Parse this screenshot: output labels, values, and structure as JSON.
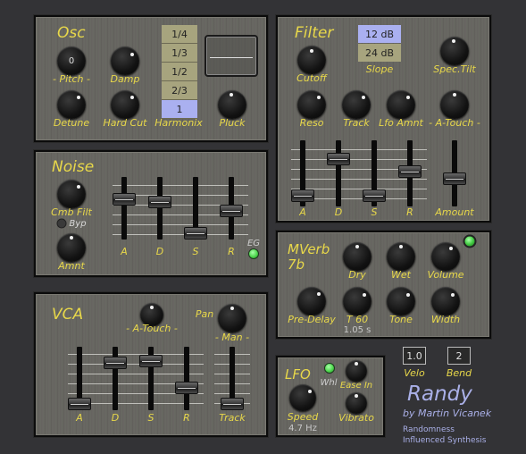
{
  "osc": {
    "title": "Osc",
    "pitch_value": "0",
    "pitch_label": "- Pitch -",
    "damp_label": "Damp",
    "detune_label": "Detune",
    "hardcut_label": "Hard Cut",
    "harmonix_label": "Harmonix",
    "harmonix_options": [
      "1/4",
      "1/3",
      "1/2",
      "2/3",
      "1"
    ],
    "harmonix_selected": "1",
    "pluck_label": "Pluck"
  },
  "filter": {
    "title": "Filter",
    "cutoff_label": "Cutoff",
    "slope_options": [
      "12 dB",
      "24 dB"
    ],
    "slope_selected": "12 dB",
    "slope_label": "Slope",
    "spectilt_label": "Spec.Tilt",
    "reso_label": "Reso",
    "track_label": "Track",
    "lfoamnt_label": "Lfo Amnt",
    "atouch_label": "- A-Touch -",
    "slider_labels": [
      "A",
      "D",
      "S",
      "R"
    ],
    "amount_label": "Amount",
    "env_levels": [
      0.08,
      0.77,
      0.08,
      0.53
    ],
    "amount_level": 0.4
  },
  "noise": {
    "title": "Noise",
    "cmbfilt_label": "Cmb Filt",
    "byp_label": "Byp",
    "amnt_label": "Amnt",
    "slider_labels": [
      "A",
      "D",
      "S",
      "R"
    ],
    "eg_label": "EG",
    "env_levels": [
      0.67,
      0.62,
      0.0,
      0.45
    ]
  },
  "vca": {
    "title": "VCA",
    "atouch_label": "- A-Touch -",
    "pan_label": "Pan",
    "man_label": "- Man -",
    "slider_labels": [
      "A",
      "D",
      "S",
      "R"
    ],
    "track_label": "Track",
    "env_levels": [
      0.0,
      0.81,
      0.85,
      0.31
    ],
    "track_level": 0.0
  },
  "mverb": {
    "title": "MVerb\n7b",
    "dry_label": "Dry",
    "wet_label": "Wet",
    "volume_label": "Volume",
    "predelay_label": "Pre-Delay",
    "t60_label": "T 60",
    "t60_value": "1.05 s",
    "tone_label": "Tone",
    "width_label": "Width"
  },
  "lfo": {
    "title": "LFO",
    "whl_label": "Whl",
    "easein_label": "Ease In",
    "speed_label": "Speed",
    "speed_value": "4.7 Hz",
    "vibrato_label": "Vibrato"
  },
  "velo": {
    "value": "1.0",
    "label": "Velo"
  },
  "bend": {
    "value": "2",
    "label": "Bend"
  },
  "brand": {
    "name": "Randy",
    "author": "by  Martin Vicanek",
    "tagline_1": "Randomness",
    "tagline_2": "Influenced Synthesis"
  },
  "colors": {
    "label_yellow": "#e8d84a",
    "selected_blue": "#aab0f0",
    "option_olive": "#a7a47e",
    "led_green": "#55dd55",
    "brand_lavender": "#aab0e8"
  }
}
